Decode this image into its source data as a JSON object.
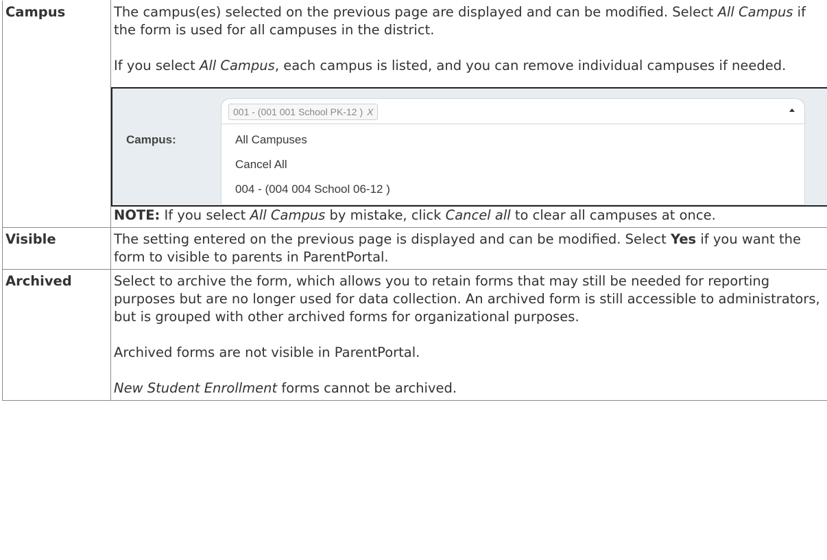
{
  "campus": {
    "term": "Campus",
    "p1": {
      "a": "The campus(es) selected on the previous page are displayed and can be modified. Select ",
      "em": "All Campus",
      "b": " if the form is used for all campuses in the district."
    },
    "p2": {
      "a": "If you select ",
      "em": "All Campus",
      "b": ", each campus is listed, and you can remove individual campuses if needed."
    },
    "screenshot": {
      "label": "Campus:",
      "chip": "001 - (001 001 School PK-12 )",
      "chip_remove": "X",
      "options": [
        "All Campuses",
        "Cancel All",
        "004 - (004 004 School 06-12 )"
      ]
    },
    "note": {
      "label": "NOTE:",
      "a": " If you select ",
      "em1": "All Campus",
      "b": " by mistake, click ",
      "em2": "Cancel all",
      "c": " to clear all campuses at once."
    }
  },
  "visible": {
    "term": "Visible",
    "a": "The setting entered on the previous page is displayed and can be modified. Select ",
    "strong": "Yes",
    "b": " if you want the form to visible to parents in ParentPortal."
  },
  "archived": {
    "term": "Archived",
    "p1": "Select to archive the form, which allows you to retain forms that may still be needed for reporting purposes but are no longer used for data collection. An archived form is still accessible to administrators, but is grouped with other archived forms for organizational purposes.",
    "p2": "Archived forms are not visible in ParentPortal.",
    "p3": {
      "em": "New Student Enrollment",
      "a": " forms cannot be archived."
    }
  }
}
